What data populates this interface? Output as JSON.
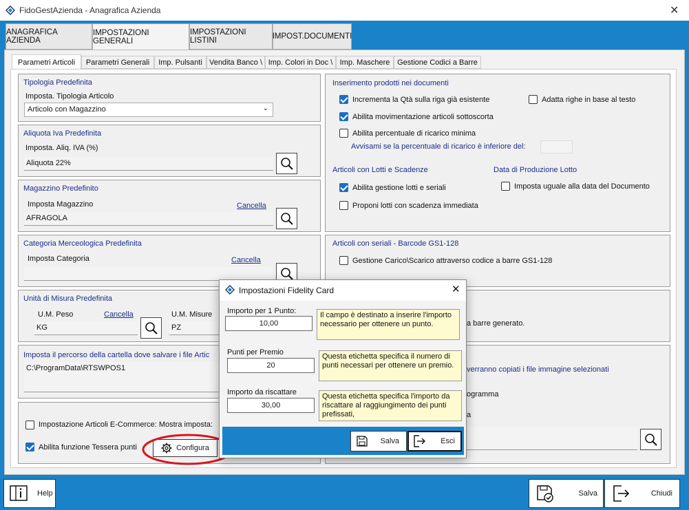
{
  "app_title": "FidoGestAzienda - Anagrafica Azienda",
  "main_tabs": [
    "ANAGRAFICA AZIENDA",
    "IMPOSTAZIONI GENERALI",
    "IMPOSTAZIONI LISTINI",
    "IMPOST.DOCUMENTI"
  ],
  "sub_tabs": [
    "Parametri Articoli",
    "Parametri Generali",
    "Imp. Pulsanti",
    "Vendita Banco \\",
    "Imp. Colori in Doc \\",
    "Imp. Maschere",
    "Gestione Codici a Barre"
  ],
  "tipologia": {
    "title": "Tipologia Predefinita",
    "label": "Imposta. Tipologia Articolo",
    "value": "Articolo con Magazzino"
  },
  "iva": {
    "title": "Aliquota Iva Predefinita",
    "label": "Imposta. Aliq. IVA (%)",
    "value": "Aliquota 22%"
  },
  "magazzino": {
    "title": "Magazzino Predefinito",
    "label": "Imposta Magazzino",
    "link": "Cancella",
    "value": "AFRAGOLA"
  },
  "categoria": {
    "title": "Categoria Merceologica Predefinita",
    "label": "Imposta Categoria",
    "link": "Cancella",
    "value": ""
  },
  "um": {
    "title": "Unità di Misura Predefinita",
    "peso_label": "U.M. Peso",
    "peso_link": "Cancella",
    "peso_value": "KG",
    "misure_label": "U.M. Misure",
    "misure_value": "PZ"
  },
  "percorso": {
    "title": "Imposta il percorso della cartella dove salvare i file Artic",
    "value": "C:\\ProgramData\\RTSWPOS1"
  },
  "ecommerce_label": "Impostazione Articoli E-Commerce: Mostra imposta:",
  "tessera_label": "Abilita funzione Tessera punti",
  "configura_label": "Configura",
  "inserimento": {
    "title": "Inserimento prodotti nei documenti",
    "incrementa": "Incrementa la Qtà  sulla riga già esistente",
    "adatta": "Adatta righe in base al testo",
    "movimentazione": "Abilita movimentazione articoli sottoscorta",
    "ricarico": "Abilita percentuale di ricarico minima",
    "avvisami": "Avvisami se la percentuale di ricarico è inferiore del:"
  },
  "lotti": {
    "title": "Articoli con Lotti e Scadenze",
    "gestione": "Abilita gestione lotti e seriali",
    "proponi": "Proponi lotti con scadenza immediata",
    "data_title": "Data di Produzione Lotto",
    "data_label": "Imposta uguale alla data del Documento"
  },
  "seriali": {
    "title": "Articoli con seriali - Barcode GS1-128",
    "gestione": "Gestione Carico\\Scarico attraverso codice a barre GS1-128"
  },
  "right_partial": {
    "barre": "a barre generato.",
    "copiati": "verranno copiati i file immagine selezionati",
    "programma": "ogramma",
    "a": "a"
  },
  "dialog": {
    "title": "Impostazioni Fidelity Card",
    "f1_label": "Importo per 1 Punto:",
    "f1_value": "10,00",
    "f1_tip": "Il campo è destinato a inserire l'importo necessario per ottenere un punto.",
    "f2_label": "Punti per Premio",
    "f2_value": "20",
    "f2_tip": "Questa etichetta specifica il numero di punti necessari per ottenere un premio.",
    "f3_label": "Importo da riscattare",
    "f3_value": "30,00",
    "f3_tip": "Questa etichetta specifica l'importo da riscattare al raggiungimento dei punti prefissati,",
    "save": "Salva",
    "exit": "Esci"
  },
  "bottom": {
    "help": "Help",
    "save": "Salva",
    "exit": "Chiudi"
  },
  "colors": {
    "accent": "#1a82c8",
    "link": "#1b2d8a",
    "highlight": "#d9141e"
  }
}
